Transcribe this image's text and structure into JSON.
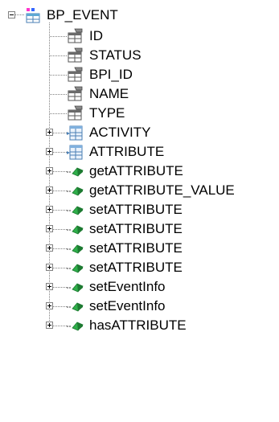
{
  "tree": {
    "root": {
      "label": "BP_EVENT",
      "icon": "table-icon",
      "expanded": true,
      "children": [
        {
          "label": "ID",
          "icon": "column-icon"
        },
        {
          "label": "STATUS",
          "icon": "column-icon"
        },
        {
          "label": "BPI_ID",
          "icon": "column-icon"
        },
        {
          "label": "NAME",
          "icon": "column-icon"
        },
        {
          "label": "TYPE",
          "icon": "column-icon"
        },
        {
          "label": "ACTIVITY",
          "icon": "relation-icon",
          "collapsed": true
        },
        {
          "label": "ATTRIBUTE",
          "icon": "relation-icon",
          "collapsed": true
        },
        {
          "label": "getATTRIBUTE",
          "icon": "method-icon",
          "collapsed": true
        },
        {
          "label": "getATTRIBUTE_VALUE",
          "icon": "method-icon",
          "collapsed": true
        },
        {
          "label": "setATTRIBUTE",
          "icon": "method-icon",
          "collapsed": true
        },
        {
          "label": "setATTRIBUTE",
          "icon": "method-icon",
          "collapsed": true
        },
        {
          "label": "setATTRIBUTE",
          "icon": "method-icon",
          "collapsed": true
        },
        {
          "label": "setATTRIBUTE",
          "icon": "method-icon",
          "collapsed": true
        },
        {
          "label": "setEventInfo",
          "icon": "method-icon",
          "collapsed": true
        },
        {
          "label": "setEventInfo",
          "icon": "method-icon",
          "collapsed": true
        },
        {
          "label": "hasATTRIBUTE",
          "icon": "method-icon",
          "collapsed": true
        }
      ]
    }
  }
}
